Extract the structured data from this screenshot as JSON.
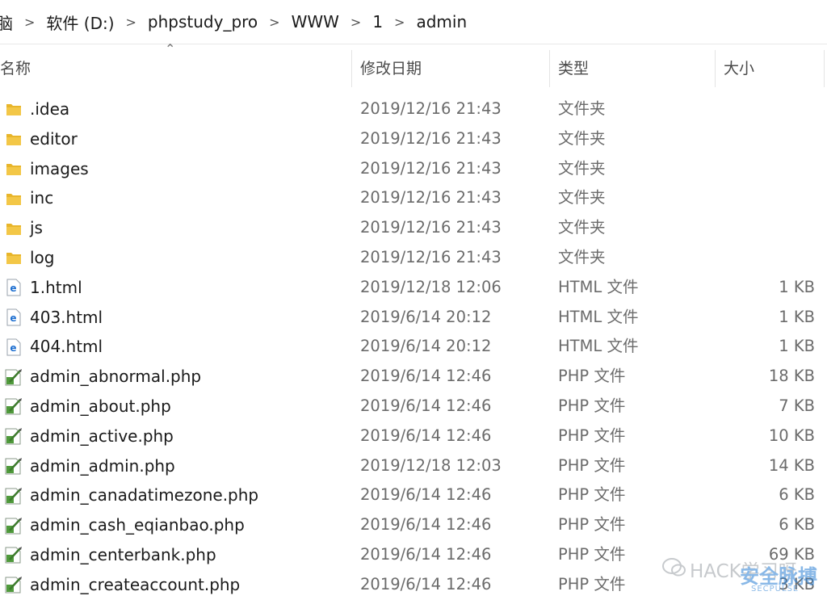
{
  "breadcrumb": {
    "prefix": "脑",
    "segments": [
      "软件 (D:)",
      "phpstudy_pro",
      "WWW",
      "1",
      "admin"
    ]
  },
  "columns": {
    "name": "名称",
    "date": "修改日期",
    "type": "类型",
    "size": "大小"
  },
  "files": [
    {
      "name": ".idea",
      "date": "2019/12/16 21:43",
      "type": "文件夹",
      "size": "",
      "icon": "folder-icon"
    },
    {
      "name": "editor",
      "date": "2019/12/16 21:43",
      "type": "文件夹",
      "size": "",
      "icon": "folder-icon"
    },
    {
      "name": "images",
      "date": "2019/12/16 21:43",
      "type": "文件夹",
      "size": "",
      "icon": "folder-icon"
    },
    {
      "name": "inc",
      "date": "2019/12/16 21:43",
      "type": "文件夹",
      "size": "",
      "icon": "folder-icon"
    },
    {
      "name": "js",
      "date": "2019/12/16 21:43",
      "type": "文件夹",
      "size": "",
      "icon": "folder-icon"
    },
    {
      "name": "log",
      "date": "2019/12/16 21:43",
      "type": "文件夹",
      "size": "",
      "icon": "folder-icon"
    },
    {
      "name": "1.html",
      "date": "2019/12/18 12:06",
      "type": "HTML 文件",
      "size": "1 KB",
      "icon": "html-file-icon"
    },
    {
      "name": "403.html",
      "date": "2019/6/14 20:12",
      "type": "HTML 文件",
      "size": "1 KB",
      "icon": "html-file-icon"
    },
    {
      "name": "404.html",
      "date": "2019/6/14 20:12",
      "type": "HTML 文件",
      "size": "1 KB",
      "icon": "html-file-icon"
    },
    {
      "name": "admin_abnormal.php",
      "date": "2019/6/14 12:46",
      "type": "PHP 文件",
      "size": "18 KB",
      "icon": "php-file-icon"
    },
    {
      "name": "admin_about.php",
      "date": "2019/6/14 12:46",
      "type": "PHP 文件",
      "size": "7 KB",
      "icon": "php-file-icon"
    },
    {
      "name": "admin_active.php",
      "date": "2019/6/14 12:46",
      "type": "PHP 文件",
      "size": "10 KB",
      "icon": "php-file-icon"
    },
    {
      "name": "admin_admin.php",
      "date": "2019/12/18 12:03",
      "type": "PHP 文件",
      "size": "14 KB",
      "icon": "php-file-icon"
    },
    {
      "name": "admin_canadatimezone.php",
      "date": "2019/6/14 12:46",
      "type": "PHP 文件",
      "size": "6 KB",
      "icon": "php-file-icon"
    },
    {
      "name": "admin_cash_eqianbao.php",
      "date": "2019/6/14 12:46",
      "type": "PHP 文件",
      "size": "6 KB",
      "icon": "php-file-icon"
    },
    {
      "name": "admin_centerbank.php",
      "date": "2019/6/14 12:46",
      "type": "PHP 文件",
      "size": "69 KB",
      "icon": "php-file-icon"
    },
    {
      "name": "admin_createaccount.php",
      "date": "2019/6/14 12:46",
      "type": "PHP 文件",
      "size": "3 KB",
      "icon": "php-file-icon"
    }
  ],
  "watermark": {
    "text": "HACK学习呀",
    "brand": "安全脉搏",
    "sub": "SECPULSE"
  },
  "colors": {
    "folder": "#e8b52a",
    "html": "#1e6fd0",
    "php": "#4f9a3b",
    "muted_text": "#6b6b6b"
  }
}
